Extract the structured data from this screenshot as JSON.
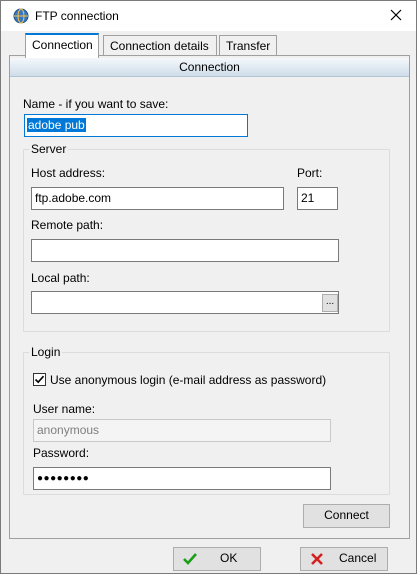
{
  "window": {
    "title": "FTP connection",
    "icon": "app-globe-icon",
    "close_icon": "close-icon"
  },
  "tabs": [
    {
      "label": "Connection",
      "active": true
    },
    {
      "label": "Connection details",
      "active": false
    },
    {
      "label": "Transfer",
      "active": false
    }
  ],
  "section": {
    "title": "Connection"
  },
  "name": {
    "label": "Name - if you want to save:",
    "value": "adobe pub"
  },
  "server": {
    "group_label": "Server",
    "host_label": "Host address:",
    "host_value": "ftp.adobe.com",
    "port_label": "Port:",
    "port_value": "21",
    "remote_label": "Remote path:",
    "remote_value": "",
    "local_label": "Local path:",
    "local_value": "",
    "browse_label": "..."
  },
  "login": {
    "group_label": "Login",
    "anonymous_checked": true,
    "anonymous_label": "Use anonymous login (e-mail address as password)",
    "user_label": "User name:",
    "user_value": "anonymous",
    "password_label": "Password:",
    "password_value": "●●●●●●●●"
  },
  "buttons": {
    "connect": "Connect",
    "ok": "OK",
    "cancel": "Cancel"
  },
  "colors": {
    "accent": "#0078d7",
    "ok_check": "#1a9e1a",
    "cancel_x": "#d42020"
  }
}
